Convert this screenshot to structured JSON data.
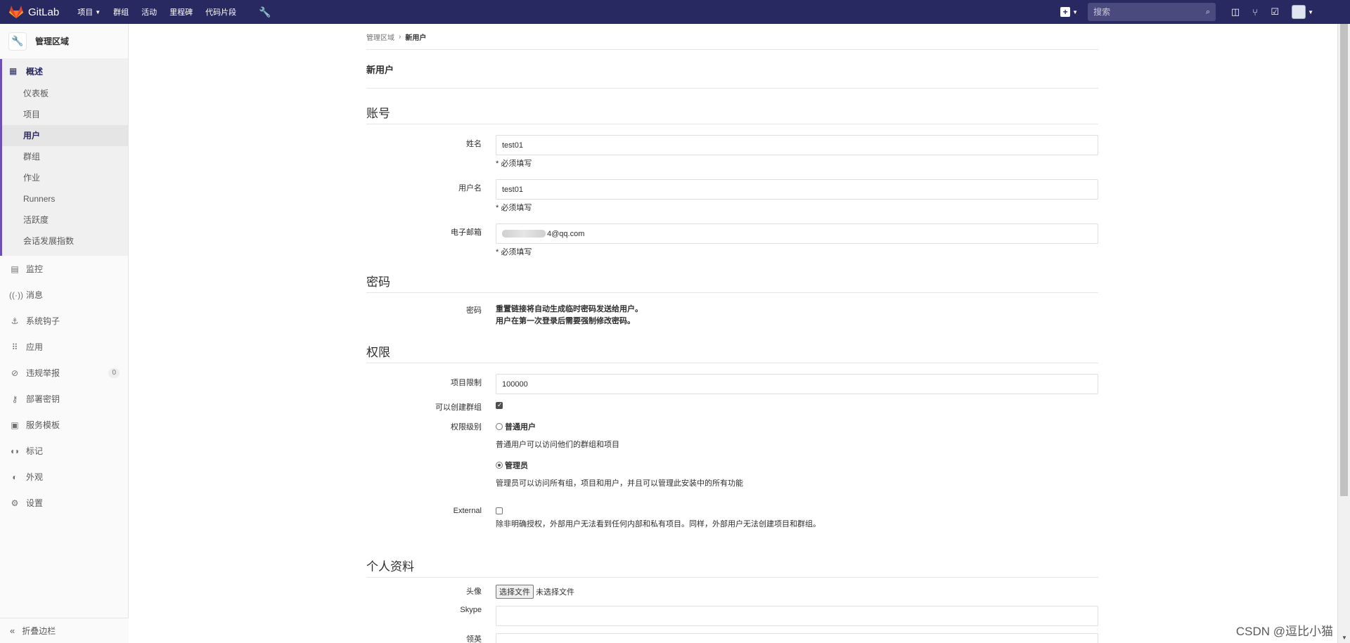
{
  "topbar": {
    "logo_text": "GitLab",
    "nav": [
      "项目",
      "群组",
      "活动",
      "里程碑",
      "代码片段"
    ],
    "search_placeholder": "搜索",
    "colors": {
      "navbar": "#292961",
      "accent": "#6b4fbb"
    }
  },
  "sidebar": {
    "context_title": "管理区域",
    "section_title": "概述",
    "sub_items": [
      "仪表板",
      "项目",
      "用户",
      "群组",
      "作业",
      "Runners",
      "活跃度",
      "会话发展指数"
    ],
    "active_sub": "用户",
    "items": [
      {
        "label": "监控",
        "icon": "monitor-icon"
      },
      {
        "label": "消息",
        "icon": "broadcast-icon"
      },
      {
        "label": "系统钩子",
        "icon": "hook-icon"
      },
      {
        "label": "应用",
        "icon": "apps-icon"
      },
      {
        "label": "违规举报",
        "icon": "report-icon",
        "badge": "0"
      },
      {
        "label": "部署密钥",
        "icon": "key-icon"
      },
      {
        "label": "服务模板",
        "icon": "template-icon"
      },
      {
        "label": "标记",
        "icon": "label-icon"
      },
      {
        "label": "外观",
        "icon": "appearance-icon"
      },
      {
        "label": "设置",
        "icon": "gear-icon"
      }
    ],
    "collapse_label": "折叠边栏"
  },
  "breadcrumb": {
    "parent": "管理区域",
    "current": "新用户"
  },
  "page_title": "新用户",
  "account": {
    "title": "账号",
    "name_label": "姓名",
    "name_value": "test01",
    "username_label": "用户名",
    "username_value": "test01",
    "email_label": "电子邮箱",
    "email_visible_suffix": "4@qq.com",
    "required_hint": "* 必须填写"
  },
  "password": {
    "title": "密码",
    "label": "密码",
    "line1": "重置链接将自动生成临时密码发送给用户。",
    "line2": "用户在第一次登录后需要强制修改密码。"
  },
  "permissions": {
    "title": "权限",
    "project_limit_label": "项目限制",
    "project_limit_value": "100000",
    "can_create_group_label": "可以创建群组",
    "can_create_group": true,
    "access_level_label": "权限级别",
    "regular_label": "普通用户",
    "regular_desc": "普通用户可以访问他们的群组和项目",
    "admin_label": "管理员",
    "admin_desc": "管理员可以访问所有组，项目和用户，并且可以管理此安装中的所有功能",
    "selected_level": "管理员",
    "external_label": "External",
    "external_desc": "除非明确授权，外部用户无法看到任何内部和私有项目。同样，外部用户无法创建项目和群组。"
  },
  "profile": {
    "title": "个人资料",
    "avatar_label": "头像",
    "file_button": "选择文件",
    "file_none": "未选择文件",
    "skype_label": "Skype",
    "linkedin_label": "领英"
  },
  "watermark": "CSDN @逗比小猫"
}
